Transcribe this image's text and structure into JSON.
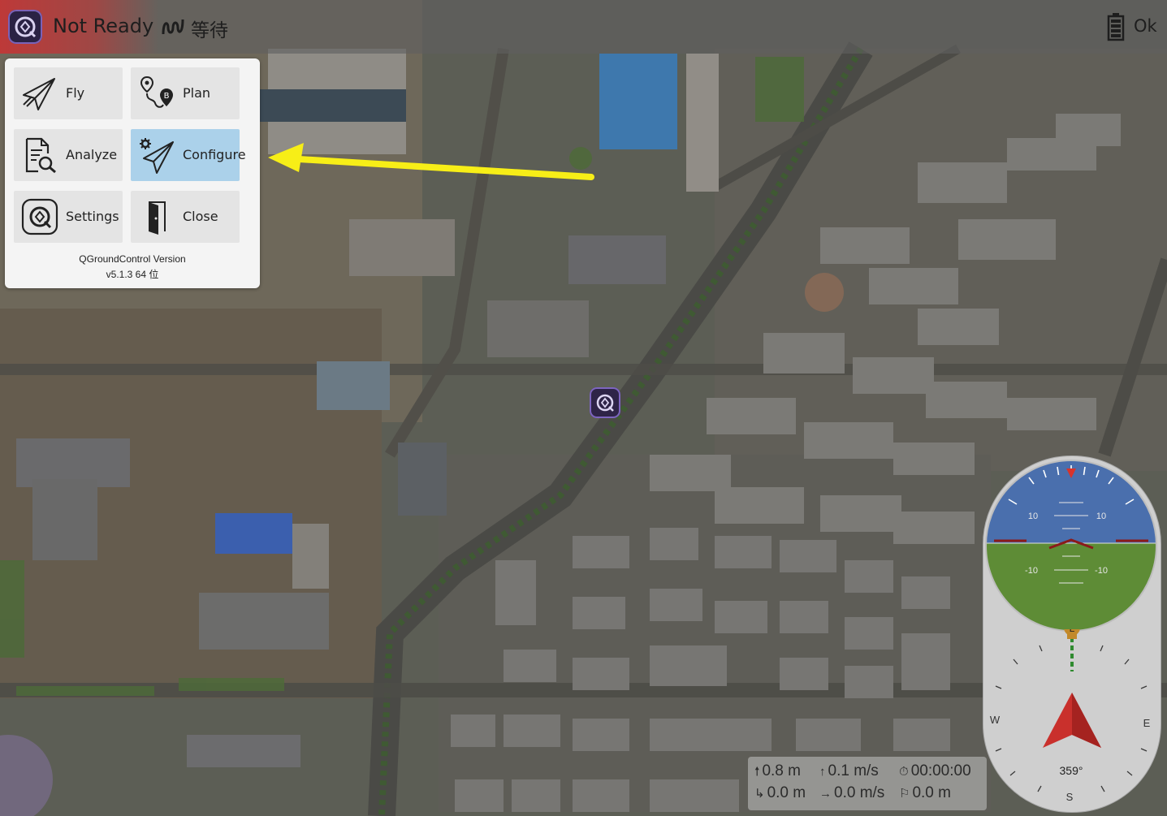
{
  "toolbar": {
    "vehicle_status": "Not Ready",
    "gps_status": "等待",
    "battery_status": "Ok",
    "gps_icon": "gps-signal-icon",
    "battery_icon": "battery-icon"
  },
  "tool_menu": {
    "items": [
      {
        "label": "Fly",
        "icon": "paper-plane-icon",
        "selected": false
      },
      {
        "label": "Plan",
        "icon": "route-plan-icon",
        "selected": false
      },
      {
        "label": "Analyze",
        "icon": "document-search-icon",
        "selected": false
      },
      {
        "label": "Configure",
        "icon": "gear-plane-icon",
        "selected": true
      },
      {
        "label": "Settings",
        "icon": "qgc-logo-icon",
        "selected": false
      },
      {
        "label": "Close",
        "icon": "exit-door-icon",
        "selected": false
      }
    ],
    "version_label": "QGroundControl Version",
    "version_value": "v5.1.3 64 位"
  },
  "annotation": {
    "color": "#f7ee17"
  },
  "telemetry": {
    "altitude": "0.8 m",
    "vertical_speed": "0.1 m/s",
    "flight_time": "00:00:00",
    "distance": "0.0 m",
    "horizontal_speed": "0.0 m/s",
    "distance_home": "0.0 m"
  },
  "attitude": {
    "pitch_labels": [
      "10",
      "10",
      "-10",
      "-10"
    ],
    "sky_color": "#4a6fad",
    "ground_color": "#5e8c36"
  },
  "compass": {
    "heading": "359°",
    "cardinals": {
      "west": "W",
      "east": "E",
      "south": "S"
    },
    "marker": "L",
    "arrow_color": "#c9302c"
  },
  "colors": {
    "toolbar_alert": "#cd3232",
    "menu_selected": "#abd1ea"
  }
}
